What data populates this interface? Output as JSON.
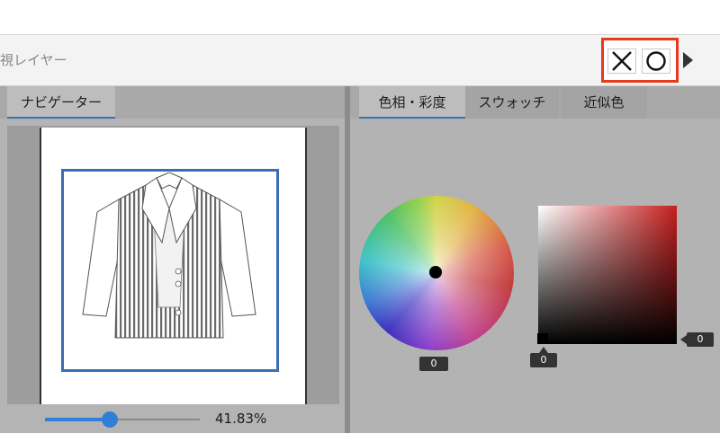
{
  "toolbar": {
    "title": "視レイヤー"
  },
  "navigator": {
    "tab_label": "ナビゲーター",
    "zoom_value": "41.83%",
    "zoom_fraction": 0.42
  },
  "color_panel": {
    "tabs": [
      {
        "label": "色相・彩度",
        "active": true
      },
      {
        "label": "スウォッチ",
        "active": false
      },
      {
        "label": "近似色",
        "active": false
      }
    ],
    "hue_value": "0",
    "saturation_value": "0",
    "brightness_value": "0"
  },
  "colors": {
    "highlight": "#e8391c",
    "accent": "#2f7fd6",
    "frame": "#3b6db3"
  }
}
